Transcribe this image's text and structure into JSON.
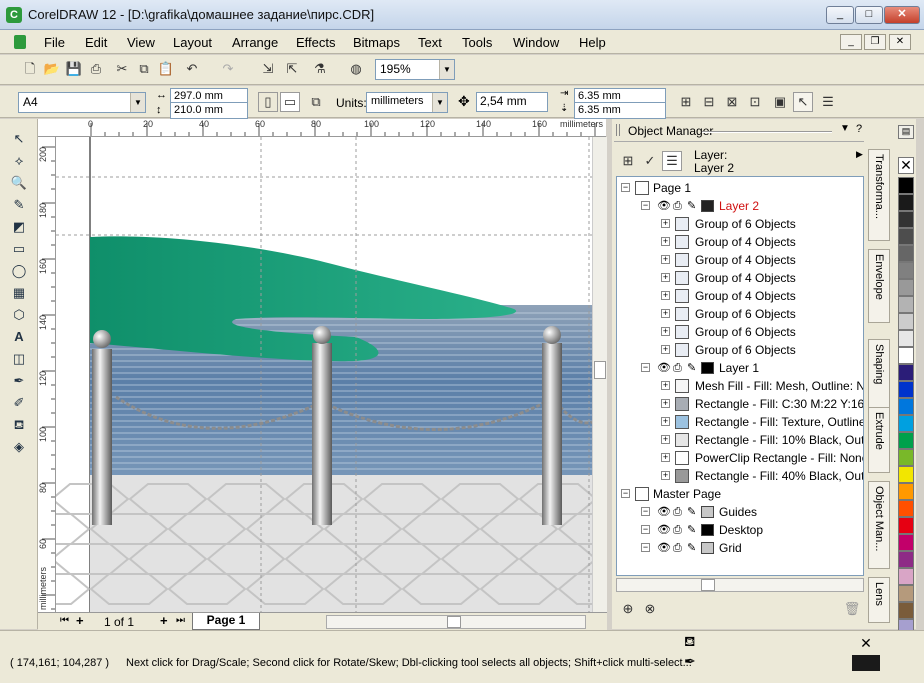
{
  "window": {
    "title": "CorelDRAW 12 - [D:\\grafika\\домашнее задание\\пирс.CDR]",
    "minimize": "_",
    "maximize": "□",
    "close": "✕"
  },
  "menu": [
    "File",
    "Edit",
    "View",
    "Layout",
    "Arrange",
    "Effects",
    "Bitmaps",
    "Text",
    "Tools",
    "Window",
    "Help"
  ],
  "toolbar": {
    "zoom": "195%"
  },
  "property_bar": {
    "page_size": "A4",
    "width": "297.0 mm",
    "height": "210.0 mm",
    "units_label": "Units:",
    "units": "millimeters",
    "nudge": "2,54 mm",
    "dup_x": "6.35 mm",
    "dup_y": "6.35 mm"
  },
  "ruler_h_labels": [
    "0",
    "20",
    "40",
    "60",
    "80",
    "100",
    "120",
    "140",
    "160"
  ],
  "ruler_h_unit": "millimeters",
  "ruler_v_labels": [
    "200",
    "180",
    "160",
    "140",
    "120",
    "100",
    "80",
    "60"
  ],
  "ruler_v_unit": "millimeters",
  "page_nav": {
    "counter": "1 of 1",
    "tab": "Page 1"
  },
  "object_manager": {
    "title": "Object Manager",
    "layer_caption": "Layer:",
    "layer_name": "Layer 2",
    "items": [
      {
        "label": "Page 1",
        "depth": 0,
        "kind": "page"
      },
      {
        "label": "Layer 2",
        "depth": 1,
        "kind": "layer",
        "color": "#d01010"
      },
      {
        "label": "Group of 6 Objects",
        "depth": 2,
        "kind": "group"
      },
      {
        "label": "Group of 4 Objects",
        "depth": 2,
        "kind": "group"
      },
      {
        "label": "Group of 4 Objects",
        "depth": 2,
        "kind": "group"
      },
      {
        "label": "Group of 4 Objects",
        "depth": 2,
        "kind": "group"
      },
      {
        "label": "Group of 4 Objects",
        "depth": 2,
        "kind": "group"
      },
      {
        "label": "Group of 6 Objects",
        "depth": 2,
        "kind": "group"
      },
      {
        "label": "Group of 6 Objects",
        "depth": 2,
        "kind": "group"
      },
      {
        "label": "Group of 6 Objects",
        "depth": 2,
        "kind": "group"
      },
      {
        "label": "Layer 1",
        "depth": 1,
        "kind": "layer",
        "color": "#000000"
      },
      {
        "label": "Mesh Fill - Fill: Mesh, Outline: No",
        "depth": 2,
        "kind": "mesh"
      },
      {
        "label": "Rectangle - Fill: C:30 M:22 Y:16 K",
        "depth": 2,
        "kind": "rect",
        "fill": "#a8adb4"
      },
      {
        "label": "Rectangle - Fill: Texture, Outline:",
        "depth": 2,
        "kind": "texture"
      },
      {
        "label": "Rectangle - Fill: 10% Black, Outli",
        "depth": 2,
        "kind": "rect",
        "fill": "#e6e6e6"
      },
      {
        "label": "PowerClip Rectangle - Fill: None,",
        "depth": 2,
        "kind": "rect",
        "fill": "#ffffff"
      },
      {
        "label": "Rectangle - Fill: 40% Black, Outli",
        "depth": 2,
        "kind": "rect",
        "fill": "#999999"
      },
      {
        "label": "Master Page",
        "depth": 0,
        "kind": "page"
      },
      {
        "label": "Guides",
        "depth": 1,
        "kind": "layer",
        "color": "#c8c8c8"
      },
      {
        "label": "Desktop",
        "depth": 1,
        "kind": "layer",
        "color": "#000000"
      },
      {
        "label": "Grid",
        "depth": 1,
        "kind": "layer",
        "color": "#c8c8c8"
      }
    ]
  },
  "side_tabs": [
    "Transforma...",
    "Envelope",
    "Shaping",
    "Extrude",
    "Object Man...",
    "Lens"
  ],
  "palette": [
    "#000000",
    "#1a1a1a",
    "#333333",
    "#4d4d4d",
    "#666666",
    "#808080",
    "#999999",
    "#b3b3b3",
    "#cccccc",
    "#e6e6e6",
    "#ffffff",
    "#2b1d78",
    "#0033cc",
    "#0077dd",
    "#00a0e0",
    "#00a04b",
    "#79b829",
    "#f2e600",
    "#ff9900",
    "#ff5000",
    "#e60012",
    "#c2006a",
    "#8e2b86",
    "#d9a5c6",
    "#b59a7c",
    "#7a5c3a",
    "#a69fcf",
    "#8f7fbf",
    "#6d5fa8"
  ],
  "status": {
    "coords": "( 174,161; 104,287 )",
    "message": "Next click for Drag/Scale; Second click for Rotate/Skew; Dbl-clicking tool selects all objects; Shift+click multi-select..."
  }
}
